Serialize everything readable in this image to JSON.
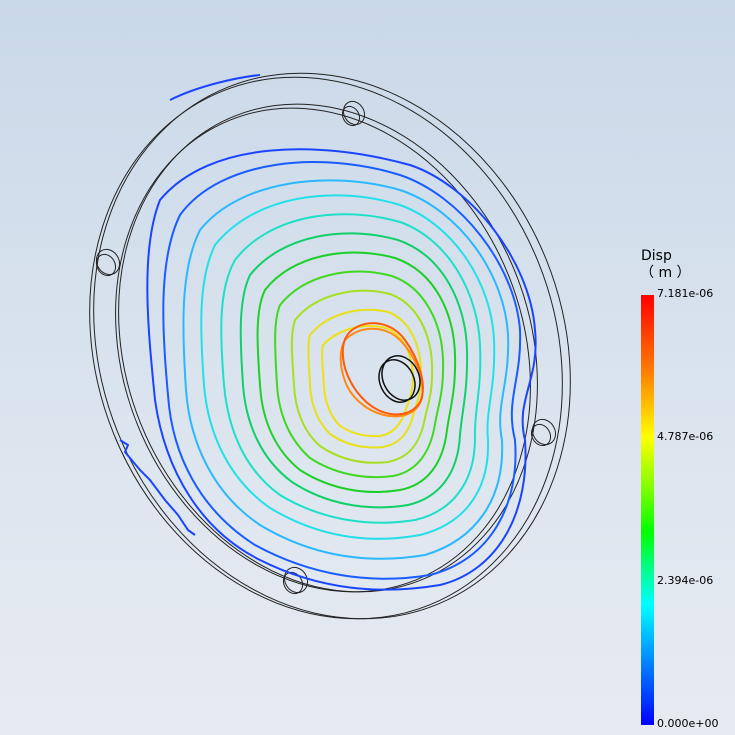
{
  "legend": {
    "title": "Disp",
    "unit": "（ m ）",
    "ticks": [
      "7.181e-06",
      "4.787e-06",
      "2.394e-06",
      "0.000e+00"
    ]
  },
  "colors": {
    "max": "#ff0000",
    "high": "#ff7f00",
    "mid_high": "#ffff00",
    "mid": "#00ff00",
    "mid_low": "#00ffff",
    "low": "#0000ff",
    "outline": "#111111"
  }
}
